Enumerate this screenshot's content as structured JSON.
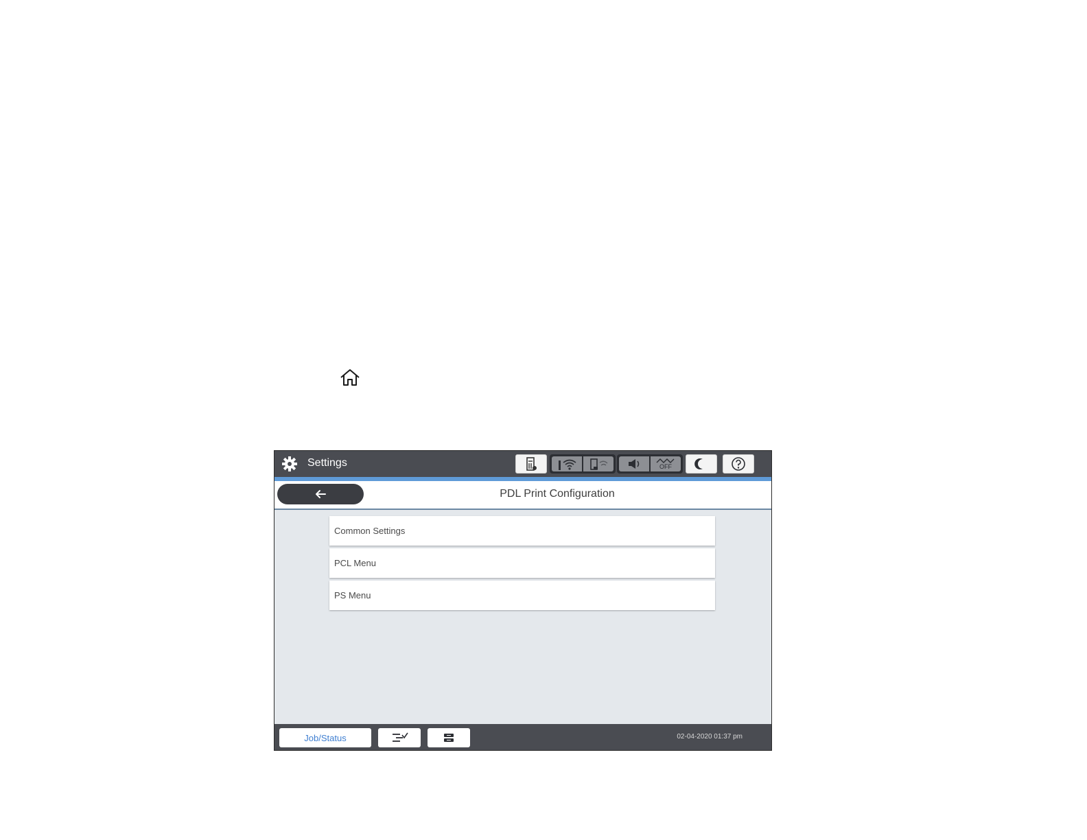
{
  "icons": {
    "home": "home-icon",
    "settings": "gear-icon",
    "status_bar": [
      "printer-status-icon",
      "wifi-icon",
      "wi-fi-direct-icon",
      "speaker-icon",
      "power-off-timer-icon",
      "sleep-moon-icon",
      "help-icon"
    ],
    "back": "arrow-left-icon",
    "bottom_bar": [
      "stop-copy-icon",
      "paper-settings-icon"
    ]
  },
  "header": {
    "app_title": "Settings"
  },
  "status_icons": {
    "power_off_label": "OFF"
  },
  "titlebar": {
    "page_title": "PDL Print Configuration"
  },
  "menu": {
    "items": [
      {
        "label": "Common Settings"
      },
      {
        "label": "PCL Menu"
      },
      {
        "label": "PS Menu"
      }
    ]
  },
  "footer": {
    "job_status_label": "Job/Status",
    "datetime": "02-04-2020 01:37 pm"
  },
  "colors": {
    "bar_background": "#4a4c52",
    "accent_blue": "#5f9bd8",
    "content_background": "#e4e8ec",
    "link_blue": "#3f7fd1"
  }
}
